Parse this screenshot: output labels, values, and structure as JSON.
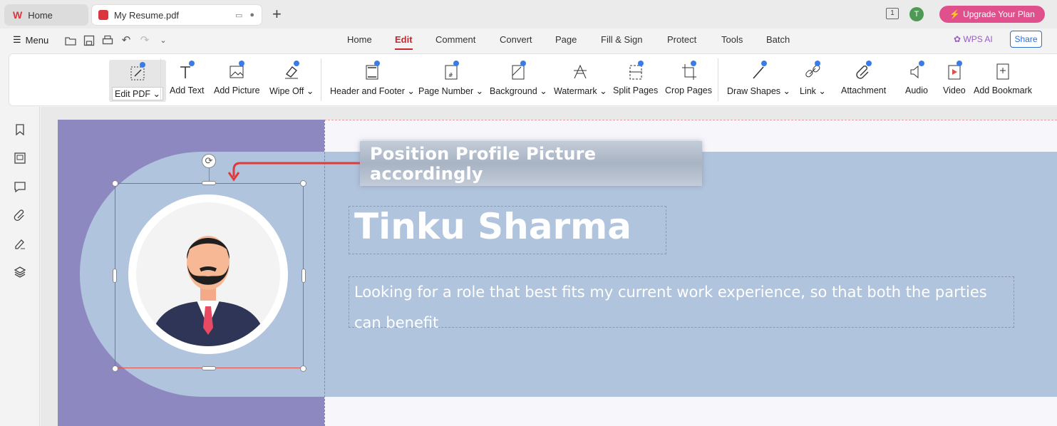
{
  "tabs": {
    "home_label": "Home",
    "doc_label": "My Resume.pdf"
  },
  "titlebar": {
    "page_indicator": "1",
    "avatar_initial": "T",
    "upgrade_label": "Upgrade Your Plan"
  },
  "menubar": {
    "menu_label": "Menu",
    "nav": [
      "Home",
      "Edit",
      "Comment",
      "Convert",
      "Page",
      "Fill & Sign",
      "Protect",
      "Tools",
      "Batch"
    ],
    "active_nav": "Edit",
    "wps_ai_label": "WPS AI",
    "share_label": "Share"
  },
  "ribbon": {
    "items": [
      {
        "label": "Edit PDF",
        "icon": "edit-pdf-icon",
        "dropdown": true
      },
      {
        "label": "Add Text",
        "icon": "add-text-icon"
      },
      {
        "label": "Add Picture",
        "icon": "add-picture-icon"
      },
      {
        "label": "Wipe Off",
        "icon": "eraser-icon",
        "dropdown": true
      },
      {
        "label": "Header and Footer",
        "icon": "header-footer-icon",
        "dropdown": true
      },
      {
        "label": "Page Number",
        "icon": "page-number-icon",
        "dropdown": true
      },
      {
        "label": "Background",
        "icon": "background-icon",
        "dropdown": true
      },
      {
        "label": "Watermark",
        "icon": "watermark-icon",
        "dropdown": true
      },
      {
        "label": "Split Pages",
        "icon": "split-pages-icon"
      },
      {
        "label": "Crop Pages",
        "icon": "crop-pages-icon"
      },
      {
        "label": "Draw Shapes",
        "icon": "draw-shapes-icon",
        "dropdown": true
      },
      {
        "label": "Link",
        "icon": "link-icon",
        "dropdown": true
      },
      {
        "label": "Attachment",
        "icon": "attachment-icon"
      },
      {
        "label": "Audio",
        "icon": "audio-icon"
      },
      {
        "label": "Video",
        "icon": "video-icon"
      },
      {
        "label": "Add Bookmark",
        "icon": "add-bookmark-icon"
      }
    ]
  },
  "document": {
    "callout": "Position  Profile Picture accordingly",
    "name": "Tinku Sharma",
    "objective": "Looking for a role that best fits my current work experience, so that both the parties can benefit"
  },
  "colors": {
    "accent": "#c8272f",
    "upgrade": "#e0508c",
    "sidebar_purple": "#8e88c1",
    "band_blue": "#b0c4dd"
  }
}
